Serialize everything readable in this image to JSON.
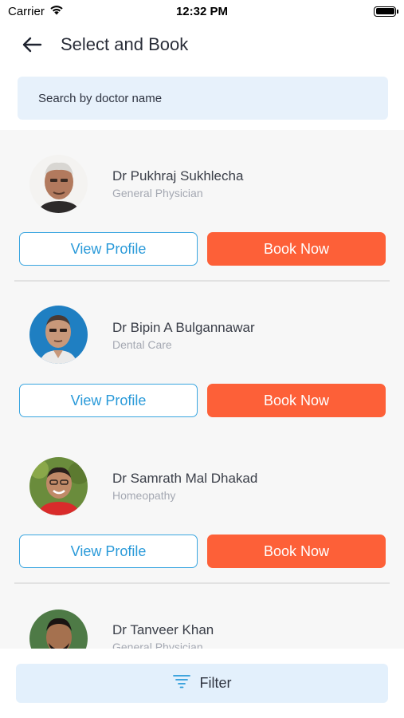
{
  "status_bar": {
    "carrier": "Carrier",
    "time": "12:32 PM"
  },
  "header": {
    "title": "Select and Book"
  },
  "search": {
    "placeholder": "Search by doctor name",
    "value": ""
  },
  "doctors": [
    {
      "name": "Dr Pukhraj Sukhlecha",
      "specialty": "General Physician",
      "view_label": "View Profile",
      "book_label": "Book Now"
    },
    {
      "name": "Dr Bipin A Bulgannawar",
      "specialty": "Dental Care",
      "view_label": "View Profile",
      "book_label": "Book Now"
    },
    {
      "name": "Dr Samrath Mal Dhakad",
      "specialty": "Homeopathy",
      "view_label": "View Profile",
      "book_label": "Book Now"
    },
    {
      "name": "Dr Tanveer Khan",
      "specialty": "General Physician"
    }
  ],
  "filter": {
    "label": "Filter"
  },
  "colors": {
    "accent_blue": "#2a9ad9",
    "book_orange": "#fd6038",
    "search_bg": "#e7f1fb"
  }
}
